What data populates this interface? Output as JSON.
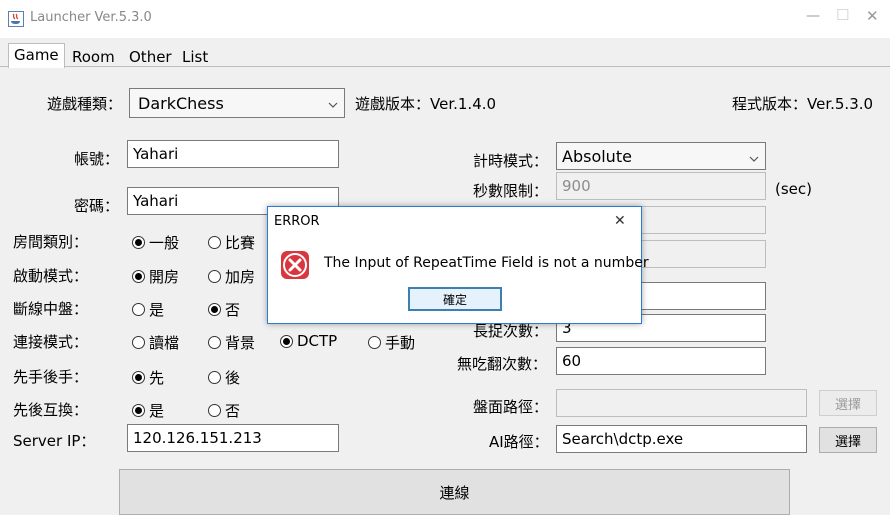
{
  "window": {
    "title": "Launcher Ver.5.3.0",
    "controls": {
      "minimize": "—",
      "maximize": "☐",
      "close": "✕"
    }
  },
  "tabs": [
    "Game",
    "Room",
    "Other",
    "List"
  ],
  "top": {
    "game_type_label": "遊戲種類：",
    "game_type_value": "DarkChess",
    "game_version": "遊戲版本：Ver.1.4.0",
    "program_version": "程式版本：Ver.5.3.0"
  },
  "left": {
    "account_label": "帳號：",
    "account_value": "Yahari",
    "password_label": "密碼：",
    "password_value": "Yahari",
    "room_type_label": "房間類別：",
    "room_type_options": [
      "一般",
      "比賽"
    ],
    "start_mode_label": "啟動模式：",
    "start_mode_options": [
      "開房",
      "加房"
    ],
    "disconnect_label": "斷線中盤：",
    "disconnect_options": [
      "是",
      "否"
    ],
    "connect_mode_label": "連接模式：",
    "connect_mode_options": [
      "讀檔",
      "背景",
      "DCTP",
      "手動"
    ],
    "first_label": "先手後手：",
    "first_options": [
      "先",
      "後"
    ],
    "swap_label": "先後互換：",
    "swap_options": [
      "是",
      "否"
    ],
    "server_ip_label": "Server IP：",
    "server_ip_value": "120.126.151.213"
  },
  "right": {
    "timer_mode_label": "計時模式：",
    "timer_mode_value": "Absolute",
    "seconds_label": "秒數限制：",
    "seconds_value": "900",
    "seconds_unit": "(sec)",
    "long_catch_label": "長捉次數：",
    "long_catch_value": "3",
    "no_capture_label": "無吃翻次數：",
    "no_capture_value": "60",
    "board_path_label": "盤面路徑：",
    "board_path_value": "",
    "ai_path_label": "AI路徑：",
    "ai_path_value": "Search\\dctp.exe",
    "choose_label": "選擇"
  },
  "connect_button": "連線",
  "dialog": {
    "title": "ERROR",
    "message": "The Input of RepeatTime Field is not a number",
    "ok_label": "確定",
    "close": "✕"
  },
  "colors": {
    "dialog_border": "#2b79d8",
    "error_icon": "#d9363e"
  }
}
